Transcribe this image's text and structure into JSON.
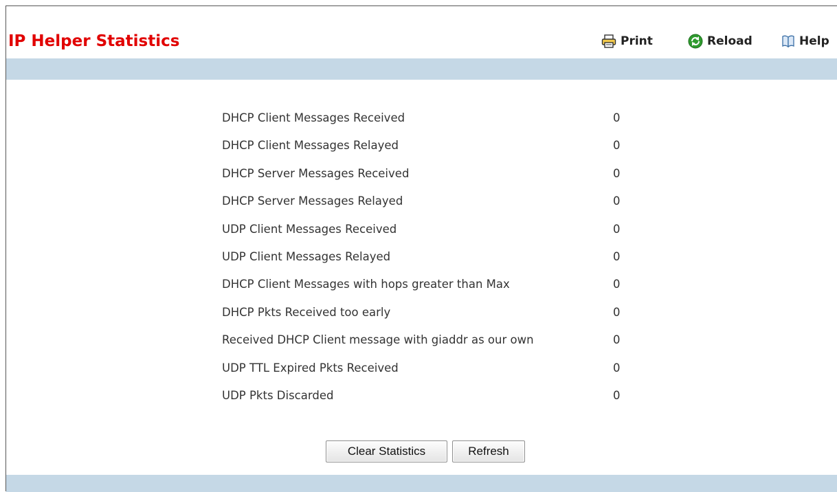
{
  "header": {
    "title": "IP Helper Statistics",
    "print_label": "Print",
    "reload_label": "Reload",
    "help_label": "Help"
  },
  "stats": {
    "rows": [
      {
        "label": "DHCP Client Messages Received",
        "value": "0"
      },
      {
        "label": "DHCP Client Messages Relayed",
        "value": "0"
      },
      {
        "label": "DHCP Server Messages Received",
        "value": "0"
      },
      {
        "label": "DHCP Server Messages Relayed",
        "value": "0"
      },
      {
        "label": "UDP Client Messages Received",
        "value": "0"
      },
      {
        "label": "UDP Client Messages Relayed",
        "value": "0"
      },
      {
        "label": "DHCP Client Messages with hops greater than Max",
        "value": "0"
      },
      {
        "label": "DHCP Pkts Received too early",
        "value": "0"
      },
      {
        "label": "Received DHCP Client message with giaddr as our own",
        "value": "0"
      },
      {
        "label": "UDP TTL Expired Pkts Received",
        "value": "0"
      },
      {
        "label": "UDP Pkts Discarded",
        "value": "0"
      }
    ]
  },
  "buttons": {
    "clear_label": "Clear Statistics",
    "refresh_label": "Refresh"
  },
  "icons": {
    "print": "printer-icon",
    "reload": "reload-icon",
    "help": "help-book-icon"
  },
  "colors": {
    "title": "#e10000",
    "band": "#c5d8e6",
    "reload_green": "#2f9b2f"
  }
}
